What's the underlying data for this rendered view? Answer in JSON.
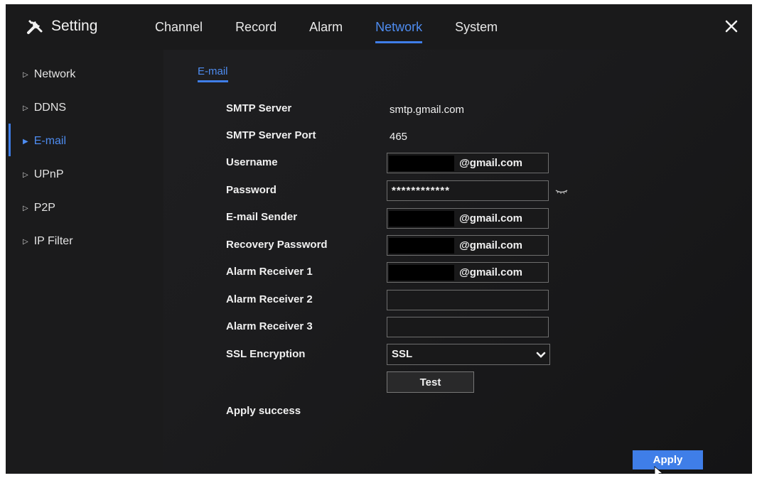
{
  "header": {
    "title": "Setting",
    "tabs": [
      {
        "label": "Channel"
      },
      {
        "label": "Record"
      },
      {
        "label": "Alarm"
      },
      {
        "label": "Network"
      },
      {
        "label": "System"
      }
    ],
    "active_tab": "Network"
  },
  "sidebar": {
    "items": [
      {
        "label": "Network"
      },
      {
        "label": "DDNS"
      },
      {
        "label": "E-mail"
      },
      {
        "label": "UPnP"
      },
      {
        "label": "P2P"
      },
      {
        "label": "IP Filter"
      }
    ],
    "active_item": "E-mail"
  },
  "section": {
    "tab_label": "E-mail"
  },
  "form": {
    "smtp_server": {
      "label": "SMTP Server",
      "value": "smtp.gmail.com"
    },
    "smtp_port": {
      "label": "SMTP Server Port",
      "value": "465"
    },
    "username": {
      "label": "Username",
      "value": "@gmail.com"
    },
    "password": {
      "label": "Password",
      "value": "************"
    },
    "sender": {
      "label": "E-mail Sender",
      "value": "@gmail.com"
    },
    "recovery": {
      "label": "Recovery Password",
      "value": "@gmail.com"
    },
    "receiver1": {
      "label": "Alarm Receiver 1",
      "value": "@gmail.com"
    },
    "receiver2": {
      "label": "Alarm Receiver 2",
      "value": ""
    },
    "receiver3": {
      "label": "Alarm Receiver 3",
      "value": ""
    },
    "ssl": {
      "label": "SSL Encryption",
      "value": "SSL"
    }
  },
  "buttons": {
    "test_label": "Test",
    "apply_label": "Apply"
  },
  "status": {
    "message": "Apply success"
  },
  "colors": {
    "accent": "#3f7ee8",
    "background": "#1c1c1e",
    "text": "#f0f0f0"
  },
  "icons": [
    "tools-icon",
    "close-icon",
    "eye-icon",
    "chevron-down-icon",
    "mouse-cursor-icon"
  ]
}
